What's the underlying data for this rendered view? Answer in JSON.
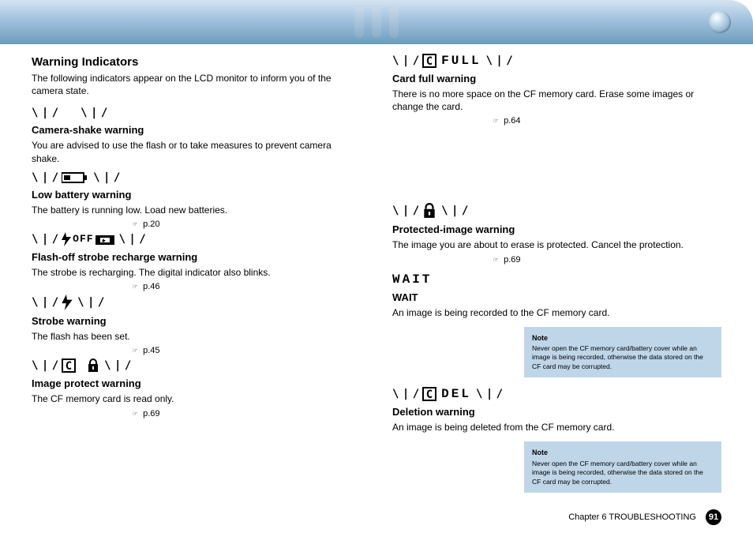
{
  "header": {
    "chapter_title": "Chapter 6 TROUBLESHOOTING"
  },
  "left": {
    "section_title": "Warning Indicators",
    "section_intro": "The following indicators appear on the LCD monitor to inform you of the camera state.",
    "items": [
      {
        "heading": "Camera-shake warning",
        "body": "You are advised to use the flash or to take measures to prevent camera shake.",
        "ref": null
      },
      {
        "heading": "Low battery warning",
        "body": "The battery is running low. Load new batteries.",
        "ref": "p.20"
      },
      {
        "heading": "Flash-off strobe recharge warning",
        "body": "The strobe is recharging. The digital indicator also blinks.",
        "ref": "p.46"
      },
      {
        "heading": "Strobe warning",
        "body": "The flash has been set.",
        "ref": "p.45"
      },
      {
        "heading": "Image protect warning",
        "body": "The CF memory card is read only.",
        "ref": "p.69"
      }
    ]
  },
  "right": {
    "items": [
      {
        "indicator": "C FULL",
        "heading": "Card full warning",
        "body": "There is no more space on the CF memory card. Erase some images or change the card.",
        "ref": "p.64"
      },
      {
        "indicator": "lock",
        "heading": "Protected-image warning",
        "body": "The image you are about to erase is protected. Cancel the protection.",
        "ref": "p.69"
      },
      {
        "indicator": "WAIT",
        "heading": "WAIT",
        "body": "An image is being recorded to the CF memory card.",
        "callout": {
          "title": "Note",
          "text": "Never open the CF memory card/battery cover while an image is being recorded, otherwise the data stored on the CF card may be corrupted."
        }
      },
      {
        "indicator": "C DEL",
        "heading": "Deletion warning",
        "body": "An image is being deleted from the CF memory card.",
        "callout": {
          "title": "Note",
          "text": "Never open the CF memory card/battery cover while an image is being recorded, otherwise the data stored on the CF card may be corrupted."
        }
      }
    ]
  },
  "footer": {
    "page": "91"
  },
  "labels": {
    "page_ref_icon": "→"
  }
}
